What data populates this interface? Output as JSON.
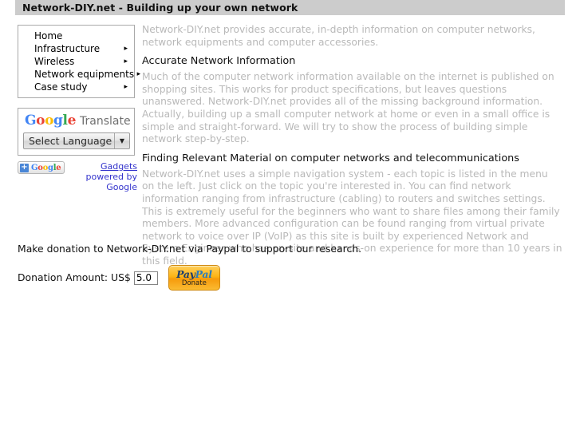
{
  "header": {
    "title": "Network-DIY.net - Building up your own network"
  },
  "sidebar": {
    "nav": {
      "items": [
        {
          "label": "Home",
          "has_arrow": false,
          "arrow": "▸"
        },
        {
          "label": "Infrastructure",
          "has_arrow": true,
          "arrow": "▸"
        },
        {
          "label": "Wireless",
          "has_arrow": true,
          "arrow": "▸"
        },
        {
          "label": "Network equipments",
          "has_arrow": true,
          "arrow": "▸"
        },
        {
          "label": "Case study",
          "has_arrow": true,
          "arrow": "▸"
        }
      ]
    },
    "translate": {
      "logo_letters": [
        {
          "char": "G",
          "color": "#4285f4"
        },
        {
          "char": "o",
          "color": "#ea4335"
        },
        {
          "char": "o",
          "color": "#fbbc05"
        },
        {
          "char": "g",
          "color": "#4285f4"
        },
        {
          "char": "l",
          "color": "#34a853"
        },
        {
          "char": "e",
          "color": "#ea4335"
        }
      ],
      "logo_text": "Google",
      "product_name": "Translate",
      "select_value": "Select Language",
      "select_arrow": "▼"
    },
    "gadget": {
      "plus_symbol": "+",
      "google_label": "Google",
      "link_text": "Gadgets",
      "credit_line_1": "powered",
      "credit_line_2": "by Google",
      "link_color": "#3333cc"
    }
  },
  "main": {
    "intro": "Network-DIY.net provides accurate, in-depth information on computer networks, network equipments and computer accessories.",
    "sections": [
      {
        "heading": "Accurate Network Information",
        "body": "Much of the computer network information available on the internet is published on shopping sites. This works for product specifications, but leaves questions unanswered. Network-DIY.net provides all of the missing background information. Actually, building up a small computer network at home or even in a small office is simple and straight-forward. We will try to show the process of building simple network step-by-step."
      },
      {
        "heading": "Finding Relevant Material on computer networks and telecommunications",
        "body": "Network-DIY.net uses a simple navigation system - each topic is listed in the menu on the left. Just click on the topic you're interested in. You can find network information ranging from infrastructure (cabling) to routers and switches settings. This is extremely useful for the beginners who want to share files among their family members. More advanced configuration can be found ranging from virtual private network to voice over IP (VoIP) as this site is built by experienced Network and System Engineer who has on-site and hands-on experience for more than 10 years in this field."
      }
    ]
  },
  "donation": {
    "intro": "Make donation to Network-DIY.net via Paypal to support our research.",
    "amount_label": "Donation Amount: US$",
    "amount_value": "5.0",
    "amount_placeholder": "",
    "paypal_pay": "Pay",
    "paypal_pal": "Pal",
    "paypal_action": "Donate"
  },
  "colors": {
    "header_bar": "#cccccc",
    "body_text": "#b9b9b9",
    "heading_text": "#111111",
    "paypal_orange": "#fcb415"
  }
}
